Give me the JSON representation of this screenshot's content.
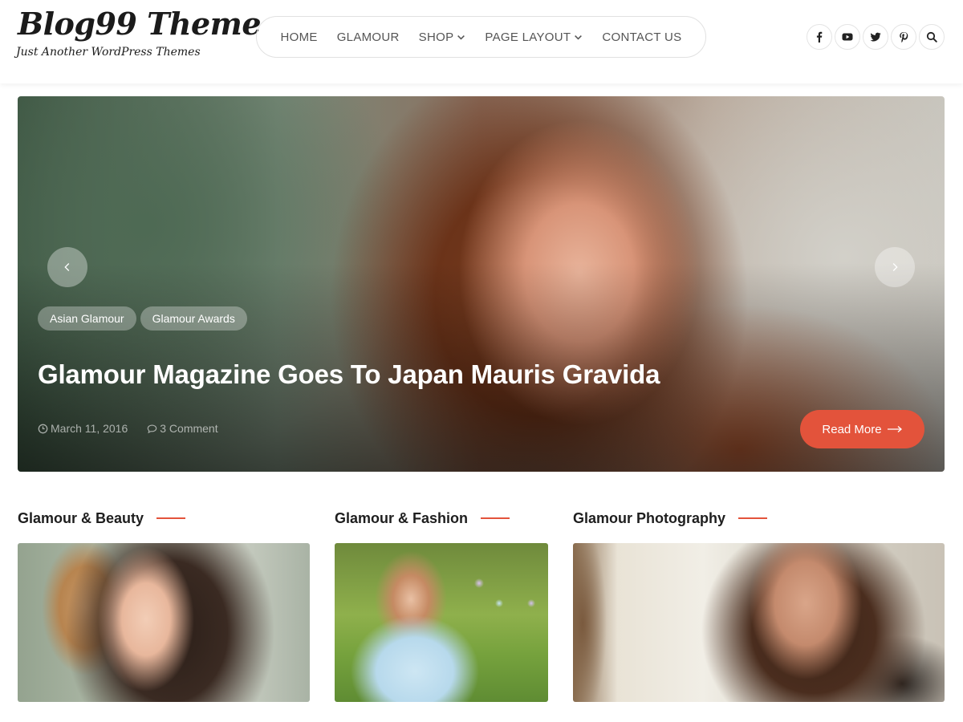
{
  "header": {
    "logo_title": "Blog99 Theme",
    "logo_tagline": "Just Another WordPress Themes",
    "nav": [
      {
        "label": "HOME",
        "has_dropdown": false
      },
      {
        "label": "GLAMOUR",
        "has_dropdown": false
      },
      {
        "label": "SHOP",
        "has_dropdown": true
      },
      {
        "label": "PAGE LAYOUT",
        "has_dropdown": true
      },
      {
        "label": "CONTACT US",
        "has_dropdown": false
      }
    ],
    "social_icons": [
      "facebook-icon",
      "youtube-icon",
      "twitter-icon",
      "pinterest-icon",
      "search-icon"
    ]
  },
  "hero": {
    "tags": [
      "Asian Glamour",
      "Glamour Awards"
    ],
    "title": "Glamour Magazine Goes To Japan Mauris Gravida",
    "date": "March 11, 2016",
    "comments": "3 Comment",
    "read_more": "Read More",
    "accent_color": "#e3533b"
  },
  "categories": [
    {
      "title": "Glamour & Beauty"
    },
    {
      "title": "Glamour & Fashion"
    },
    {
      "title": "Glamour Photography"
    }
  ],
  "colors": {
    "accent": "#e3533b",
    "text_dark": "#1e1e1e",
    "nav_text": "#555555"
  }
}
